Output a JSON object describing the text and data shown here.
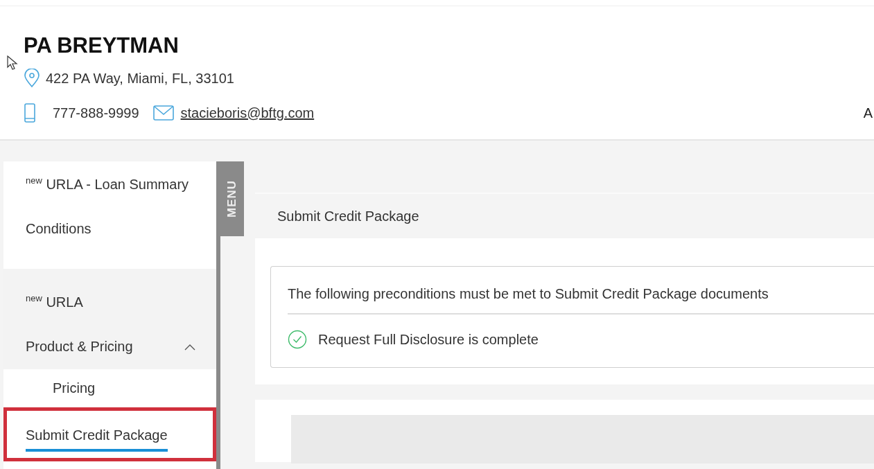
{
  "header": {
    "name": "PA BREYTMAN",
    "address": "422 PA Way, Miami, FL, 33101",
    "phone": "777-888-9999",
    "email": "stacieboris@bftg.com",
    "right_text": "A"
  },
  "sidebar": {
    "menu_tab": "MENU",
    "items": [
      {
        "kind": "link",
        "badge": "new",
        "label": "URLA - Loan Summary",
        "selected": false
      },
      {
        "kind": "link",
        "label": "Conditions",
        "selected": false
      },
      {
        "kind": "group",
        "badge": "new",
        "label": "URLA",
        "selected": false
      },
      {
        "kind": "group",
        "label": "Product & Pricing",
        "expanded": true,
        "selected": false
      },
      {
        "kind": "sub",
        "label": "Pricing",
        "selected": false
      },
      {
        "kind": "link",
        "label": "Submit Credit Package",
        "selected": true,
        "highlighted": true
      }
    ]
  },
  "panel": {
    "title": "Submit Credit Package",
    "intro": "The following preconditions must be met to Submit Credit Package documents",
    "conditions": [
      {
        "label": "Request Full Disclosure is complete",
        "complete": true
      }
    ]
  }
}
